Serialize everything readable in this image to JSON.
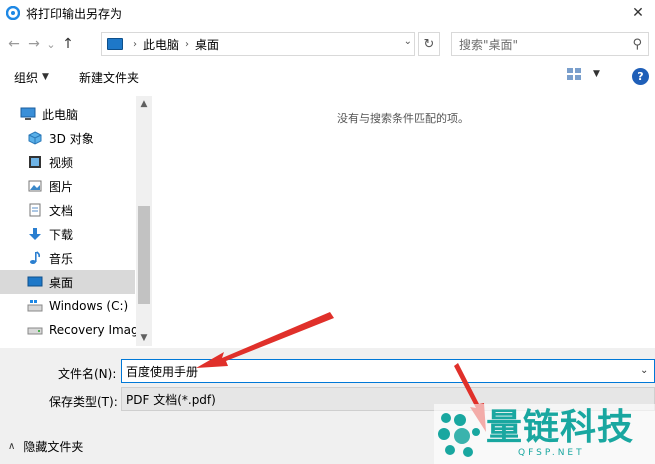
{
  "window": {
    "title": "将打印输出另存为",
    "close_glyph": "✕"
  },
  "nav": {
    "back_glyph": "←",
    "forward_glyph": "→",
    "recent_glyph": "⌄",
    "up_glyph": "↑",
    "breadcrumb": [
      "此电脑",
      "桌面"
    ],
    "refresh_glyph": "↻",
    "search_placeholder": "搜索\"桌面\""
  },
  "toolbar": {
    "organize_label": "组织",
    "new_folder_label": "新建文件夹",
    "help_label": "?"
  },
  "tree": {
    "items": [
      {
        "label": "此电脑",
        "icon": "pc-icon"
      },
      {
        "label": "3D 对象",
        "icon": "cube-icon"
      },
      {
        "label": "视频",
        "icon": "video-icon"
      },
      {
        "label": "图片",
        "icon": "pictures-icon"
      },
      {
        "label": "文档",
        "icon": "document-icon"
      },
      {
        "label": "下载",
        "icon": "download-icon"
      },
      {
        "label": "音乐",
        "icon": "music-icon"
      },
      {
        "label": "桌面",
        "icon": "desktop-icon"
      },
      {
        "label": "Windows (C:)",
        "icon": "windows-drive-icon"
      },
      {
        "label": "Recovery Imag",
        "icon": "drive-icon"
      }
    ],
    "selected": "桌面"
  },
  "content": {
    "empty_message": "没有与搜索条件匹配的项。"
  },
  "form": {
    "filename_label": "文件名(N):",
    "filename_value": "百度使用手册",
    "filetype_label": "保存类型(T):",
    "filetype_value": "PDF 文档(*.pdf)",
    "hide_folders_label": "隐藏文件夹"
  },
  "watermark": {
    "text": "量链科技",
    "sub": "QFSP.NET"
  },
  "colors": {
    "accent": "#0078d7",
    "arrow": "#e0302a",
    "watermark": "#19a7a0"
  }
}
